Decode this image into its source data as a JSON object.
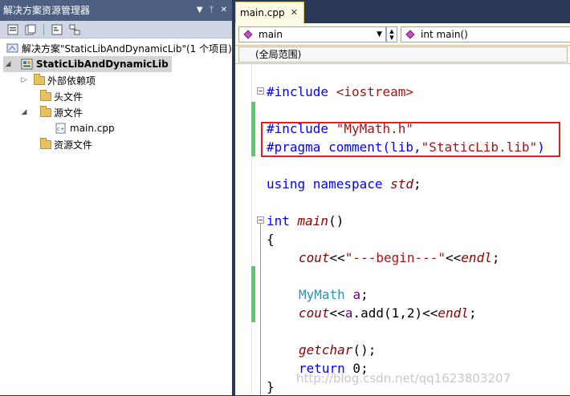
{
  "solution_explorer": {
    "title": "解决方案资源管理器",
    "pin_icon": "pin-icon",
    "close_icon": "close-icon",
    "tree": {
      "solution": "解决方案\"StaticLibAndDynamicLib\"(1 个项目)",
      "project": "StaticLibAndDynamicLib",
      "items": [
        {
          "label": "外部依赖项"
        },
        {
          "label": "头文件"
        },
        {
          "label": "源文件"
        },
        {
          "label": "main.cpp"
        },
        {
          "label": "资源文件"
        }
      ]
    }
  },
  "editor": {
    "tab": "main.cpp",
    "nav_left": "main",
    "nav_right": "int main()",
    "scope": "(全局范围)",
    "code": {
      "l1_kw": "#include",
      "l1_rest": " <iostream>",
      "l2_kw": "#include",
      "l2_rest": " \"MyMath.h\"",
      "l3_kw": "#pragma",
      "l3_a": " comment(lib,",
      "l3_b": "\"StaticLib.lib\"",
      "l3_c": ")",
      "l4_a": "using namespace ",
      "l4_b": "std",
      "l4_c": ";",
      "l5_a": "int ",
      "l5_b": "main",
      "l5_c": "()",
      "l6": "{",
      "l7_a": "cout",
      "l7_b": "<<",
      "l7_c": "\"---begin---\"",
      "l7_d": "<<",
      "l7_e": "endl",
      "l7_f": ";",
      "l8_a": "MyMath ",
      "l8_b": "a",
      "l8_c": ";",
      "l9_a": "cout",
      "l9_b": "<<",
      "l9_c": "a",
      "l9_d": ".add(1,2)<<",
      "l9_e": "endl",
      "l9_f": ";",
      "l10_a": "getchar",
      "l10_b": "();",
      "l11_a": "return",
      "l11_b": " 0;",
      "l12": "}"
    },
    "watermark": "http://blog.csdn.net/qq1623803207"
  }
}
